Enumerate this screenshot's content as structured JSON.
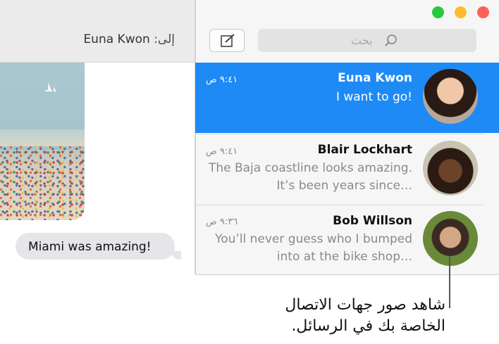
{
  "conversation": {
    "to_label": "إلى:",
    "to_name": "Euna Kwon",
    "message": "Miami was amazing!"
  },
  "sidebar": {
    "search_placeholder": "بحث",
    "conversations": [
      {
        "name": "Euna Kwon",
        "preview": "I want to go!",
        "time": "٩:٤١ ص",
        "selected": true
      },
      {
        "name": "Blair Lockhart",
        "preview": "The Baja coastline looks amazing. It’s been years since…",
        "time": "٩:٤١ ص",
        "selected": false
      },
      {
        "name": "Bob Willson",
        "preview": "You’ll never guess who I bumped into at the bike shop…",
        "time": "٩:٣٦ ص",
        "selected": false
      }
    ]
  },
  "callout": {
    "text": "شاهد صور جهات الاتصال الخاصة بك في الرسائل."
  },
  "colors": {
    "selection": "#1d8af5",
    "bubble": "#e5e5ea",
    "close": "#ff5f57",
    "minimize": "#ffbd2e",
    "zoom": "#27c93f"
  },
  "icons": [
    "compose-icon",
    "search-icon",
    "close-button",
    "minimize-button",
    "zoom-button"
  ]
}
